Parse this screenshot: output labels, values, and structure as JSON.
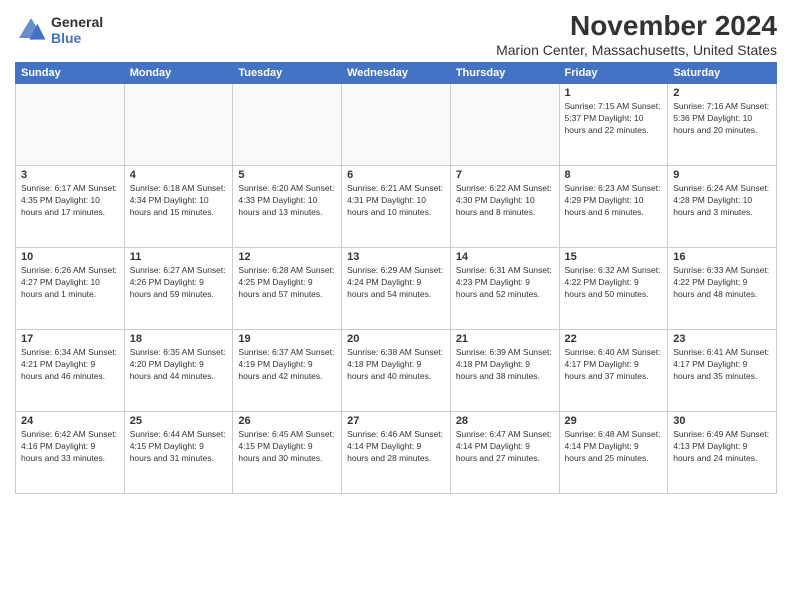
{
  "logo": {
    "line1": "General",
    "line2": "Blue"
  },
  "title": "November 2024",
  "subtitle": "Marion Center, Massachusetts, United States",
  "days_of_week": [
    "Sunday",
    "Monday",
    "Tuesday",
    "Wednesday",
    "Thursday",
    "Friday",
    "Saturday"
  ],
  "weeks": [
    [
      {
        "day": "",
        "info": "",
        "empty": true
      },
      {
        "day": "",
        "info": "",
        "empty": true
      },
      {
        "day": "",
        "info": "",
        "empty": true
      },
      {
        "day": "",
        "info": "",
        "empty": true
      },
      {
        "day": "",
        "info": "",
        "empty": true
      },
      {
        "day": "1",
        "info": "Sunrise: 7:15 AM\nSunset: 5:37 PM\nDaylight: 10 hours and 22 minutes."
      },
      {
        "day": "2",
        "info": "Sunrise: 7:16 AM\nSunset: 5:36 PM\nDaylight: 10 hours and 20 minutes."
      }
    ],
    [
      {
        "day": "3",
        "info": "Sunrise: 6:17 AM\nSunset: 4:35 PM\nDaylight: 10 hours and 17 minutes."
      },
      {
        "day": "4",
        "info": "Sunrise: 6:18 AM\nSunset: 4:34 PM\nDaylight: 10 hours and 15 minutes."
      },
      {
        "day": "5",
        "info": "Sunrise: 6:20 AM\nSunset: 4:33 PM\nDaylight: 10 hours and 13 minutes."
      },
      {
        "day": "6",
        "info": "Sunrise: 6:21 AM\nSunset: 4:31 PM\nDaylight: 10 hours and 10 minutes."
      },
      {
        "day": "7",
        "info": "Sunrise: 6:22 AM\nSunset: 4:30 PM\nDaylight: 10 hours and 8 minutes."
      },
      {
        "day": "8",
        "info": "Sunrise: 6:23 AM\nSunset: 4:29 PM\nDaylight: 10 hours and 6 minutes."
      },
      {
        "day": "9",
        "info": "Sunrise: 6:24 AM\nSunset: 4:28 PM\nDaylight: 10 hours and 3 minutes."
      }
    ],
    [
      {
        "day": "10",
        "info": "Sunrise: 6:26 AM\nSunset: 4:27 PM\nDaylight: 10 hours and 1 minute."
      },
      {
        "day": "11",
        "info": "Sunrise: 6:27 AM\nSunset: 4:26 PM\nDaylight: 9 hours and 59 minutes."
      },
      {
        "day": "12",
        "info": "Sunrise: 6:28 AM\nSunset: 4:25 PM\nDaylight: 9 hours and 57 minutes."
      },
      {
        "day": "13",
        "info": "Sunrise: 6:29 AM\nSunset: 4:24 PM\nDaylight: 9 hours and 54 minutes."
      },
      {
        "day": "14",
        "info": "Sunrise: 6:31 AM\nSunset: 4:23 PM\nDaylight: 9 hours and 52 minutes."
      },
      {
        "day": "15",
        "info": "Sunrise: 6:32 AM\nSunset: 4:22 PM\nDaylight: 9 hours and 50 minutes."
      },
      {
        "day": "16",
        "info": "Sunrise: 6:33 AM\nSunset: 4:22 PM\nDaylight: 9 hours and 48 minutes."
      }
    ],
    [
      {
        "day": "17",
        "info": "Sunrise: 6:34 AM\nSunset: 4:21 PM\nDaylight: 9 hours and 46 minutes."
      },
      {
        "day": "18",
        "info": "Sunrise: 6:35 AM\nSunset: 4:20 PM\nDaylight: 9 hours and 44 minutes."
      },
      {
        "day": "19",
        "info": "Sunrise: 6:37 AM\nSunset: 4:19 PM\nDaylight: 9 hours and 42 minutes."
      },
      {
        "day": "20",
        "info": "Sunrise: 6:38 AM\nSunset: 4:18 PM\nDaylight: 9 hours and 40 minutes."
      },
      {
        "day": "21",
        "info": "Sunrise: 6:39 AM\nSunset: 4:18 PM\nDaylight: 9 hours and 38 minutes."
      },
      {
        "day": "22",
        "info": "Sunrise: 6:40 AM\nSunset: 4:17 PM\nDaylight: 9 hours and 37 minutes."
      },
      {
        "day": "23",
        "info": "Sunrise: 6:41 AM\nSunset: 4:17 PM\nDaylight: 9 hours and 35 minutes."
      }
    ],
    [
      {
        "day": "24",
        "info": "Sunrise: 6:42 AM\nSunset: 4:16 PM\nDaylight: 9 hours and 33 minutes."
      },
      {
        "day": "25",
        "info": "Sunrise: 6:44 AM\nSunset: 4:15 PM\nDaylight: 9 hours and 31 minutes."
      },
      {
        "day": "26",
        "info": "Sunrise: 6:45 AM\nSunset: 4:15 PM\nDaylight: 9 hours and 30 minutes."
      },
      {
        "day": "27",
        "info": "Sunrise: 6:46 AM\nSunset: 4:14 PM\nDaylight: 9 hours and 28 minutes."
      },
      {
        "day": "28",
        "info": "Sunrise: 6:47 AM\nSunset: 4:14 PM\nDaylight: 9 hours and 27 minutes."
      },
      {
        "day": "29",
        "info": "Sunrise: 6:48 AM\nSunset: 4:14 PM\nDaylight: 9 hours and 25 minutes."
      },
      {
        "day": "30",
        "info": "Sunrise: 6:49 AM\nSunset: 4:13 PM\nDaylight: 9 hours and 24 minutes."
      }
    ]
  ]
}
